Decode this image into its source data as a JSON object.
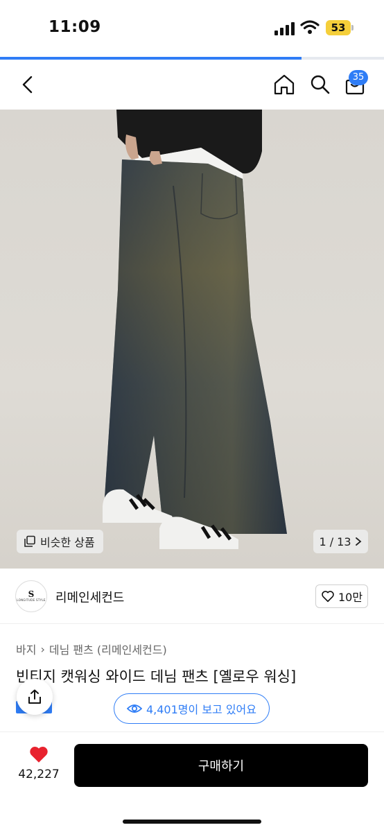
{
  "status_bar": {
    "time": "11:09",
    "battery": "53"
  },
  "scroll_progress_percent": 78.5,
  "nav": {
    "cart_count": "35"
  },
  "gallery": {
    "similar_label": "비슷한 상품",
    "page_indicator": "1 / 13"
  },
  "seller": {
    "logo_mono": "S",
    "logo_text": "LONGITUDE STYLE",
    "name": "리메인세컨드",
    "likes": "10만"
  },
  "breadcrumb": {
    "category": "바지",
    "separator": "›",
    "subcategory": "데님 팬츠 (리메인세컨드)"
  },
  "product": {
    "title": "빈티지 캣워싱 와이드 데님 팬츠 [옐로우 워싱]",
    "viewers": "4,401명이 보고 있어요"
  },
  "bottom_bar": {
    "wish_count": "42,227",
    "buy_label": "구매하기"
  },
  "colors": {
    "accent": "#2f7df6",
    "heart": "#e8222e",
    "battery": "#f5cf3a"
  }
}
